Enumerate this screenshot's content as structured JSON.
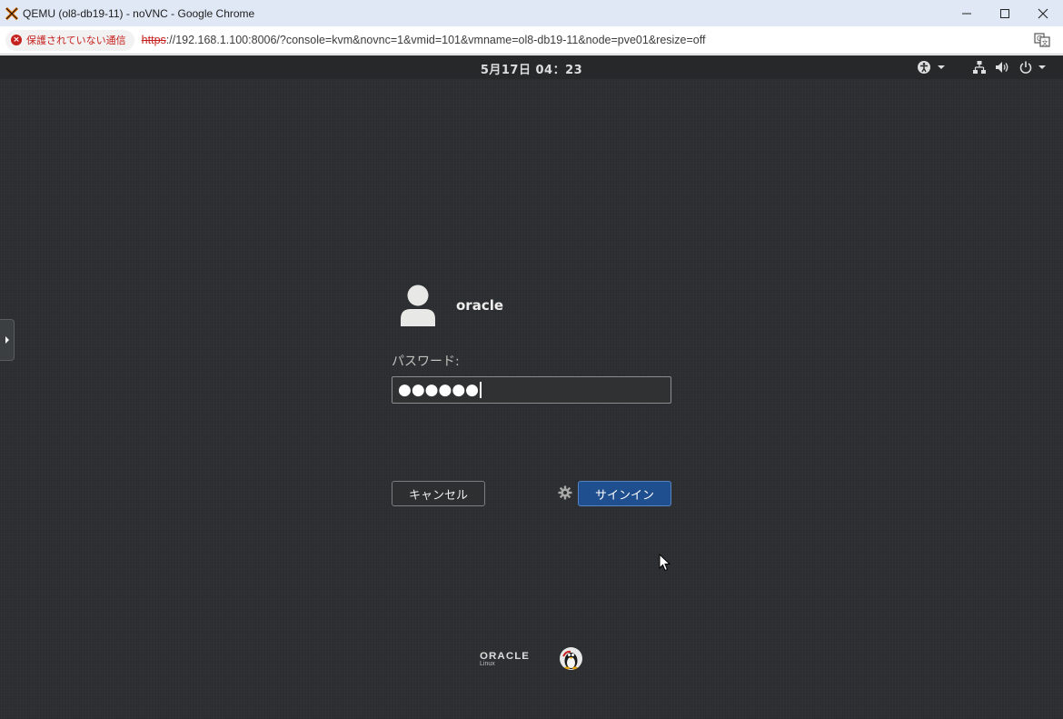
{
  "window": {
    "title": "QEMU (ol8-db19-11) - noVNC - Google Chrome"
  },
  "addressbar": {
    "security_label": "保護されていない通信",
    "url_scheme": "https",
    "url_rest": "://192.168.1.100:8006/?console=kvm&novnc=1&vmid=101&vmname=ol8-db19-11&node=pve01&resize=off"
  },
  "topbar": {
    "clock": "5月17日  04：23",
    "icons": [
      "accessibility-icon",
      "network-icon",
      "volume-icon",
      "power-icon"
    ]
  },
  "login": {
    "username": "oracle",
    "password_label": "パスワード:",
    "password_masked": "●●●●●●",
    "cancel_label": "キャンセル",
    "signin_label": "サインイン"
  },
  "branding": {
    "vendor": "ORACLE",
    "product": "Linux"
  },
  "colors": {
    "desktop_bg": "#2b2e31",
    "signin_button": "#1f4f8f",
    "insecure_red": "#c5221f"
  }
}
